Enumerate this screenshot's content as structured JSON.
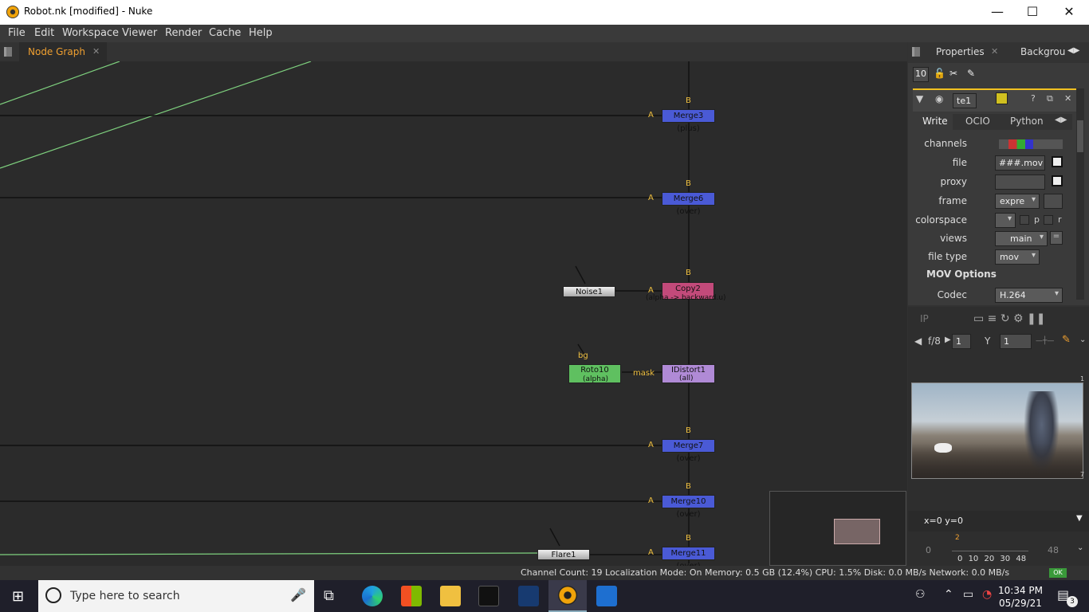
{
  "window": {
    "title": "Robot.nk [modified] - Nuke",
    "minimize": "—",
    "maximize": "☐",
    "close": "✕"
  },
  "menu": [
    "File",
    "Edit",
    "Workspace",
    "Viewer",
    "Render",
    "Cache",
    "Help"
  ],
  "nodegraph": {
    "tab": "Node Graph",
    "tab_close": "✕",
    "nodes": {
      "merge3": "Merge3 (plus)",
      "merge6": "Merge6 (over)",
      "copy2": "Copy2",
      "copy2_sub": "(alpha -> backward.u)",
      "noise1": "Noise1",
      "roto10": "Roto10",
      "roto10_sub": "(alpha)",
      "idistort1": "IDistort1",
      "idistort1_sub": "(all)",
      "merge7": "Merge7 (over)",
      "merge10": "Merge10 (over)",
      "merge11": "Merge11 (over)",
      "flare1": "Flare1"
    },
    "labels": {
      "a": "A",
      "b": "B",
      "mask": "mask",
      "bg": "bg"
    }
  },
  "properties": {
    "tabs": [
      "Properties",
      "Backgrou"
    ],
    "tab_close": "✕",
    "max_panels": "10",
    "node_name": "te1",
    "subtabs": [
      "Write",
      "OCIO",
      "Python"
    ],
    "knobs": {
      "channels": "channels",
      "file": "file",
      "file_value": "###.mov",
      "proxy": "proxy",
      "frame": "frame",
      "frame_value": "expre",
      "colorspace": "colorspace",
      "colorspace_p": "p",
      "colorspace_r": "r",
      "views": "views",
      "views_value": "main",
      "views_eq": "=",
      "file_type": "file type",
      "file_type_value": "mov",
      "section": "MOV Options",
      "codec": "Codec",
      "codec_value": "H.264"
    }
  },
  "viewer": {
    "ip": "IP",
    "fstop": "f/8",
    "frame_a": "1",
    "y_label": "Y",
    "frame_b": "1",
    "coords": "x=0 y=0",
    "timeline_start": "0",
    "timeline_end": "48",
    "current_frame": "2",
    "ticks": [
      "0",
      "10",
      "20",
      "30",
      "48"
    ],
    "tick_markers": [
      "0",
      "1",
      "7"
    ]
  },
  "status": {
    "text": "Channel Count: 19  Localization Mode: On  Memory: 0.5 GB (12.4%)  CPU: 1.5%  Disk: 0.0 MB/s  Network: 0.0 MB/s",
    "ok": "OK"
  },
  "taskbar": {
    "search_placeholder": "Type here to search",
    "time": "10:34 PM",
    "date": "05/29/21",
    "notifications": "3"
  }
}
